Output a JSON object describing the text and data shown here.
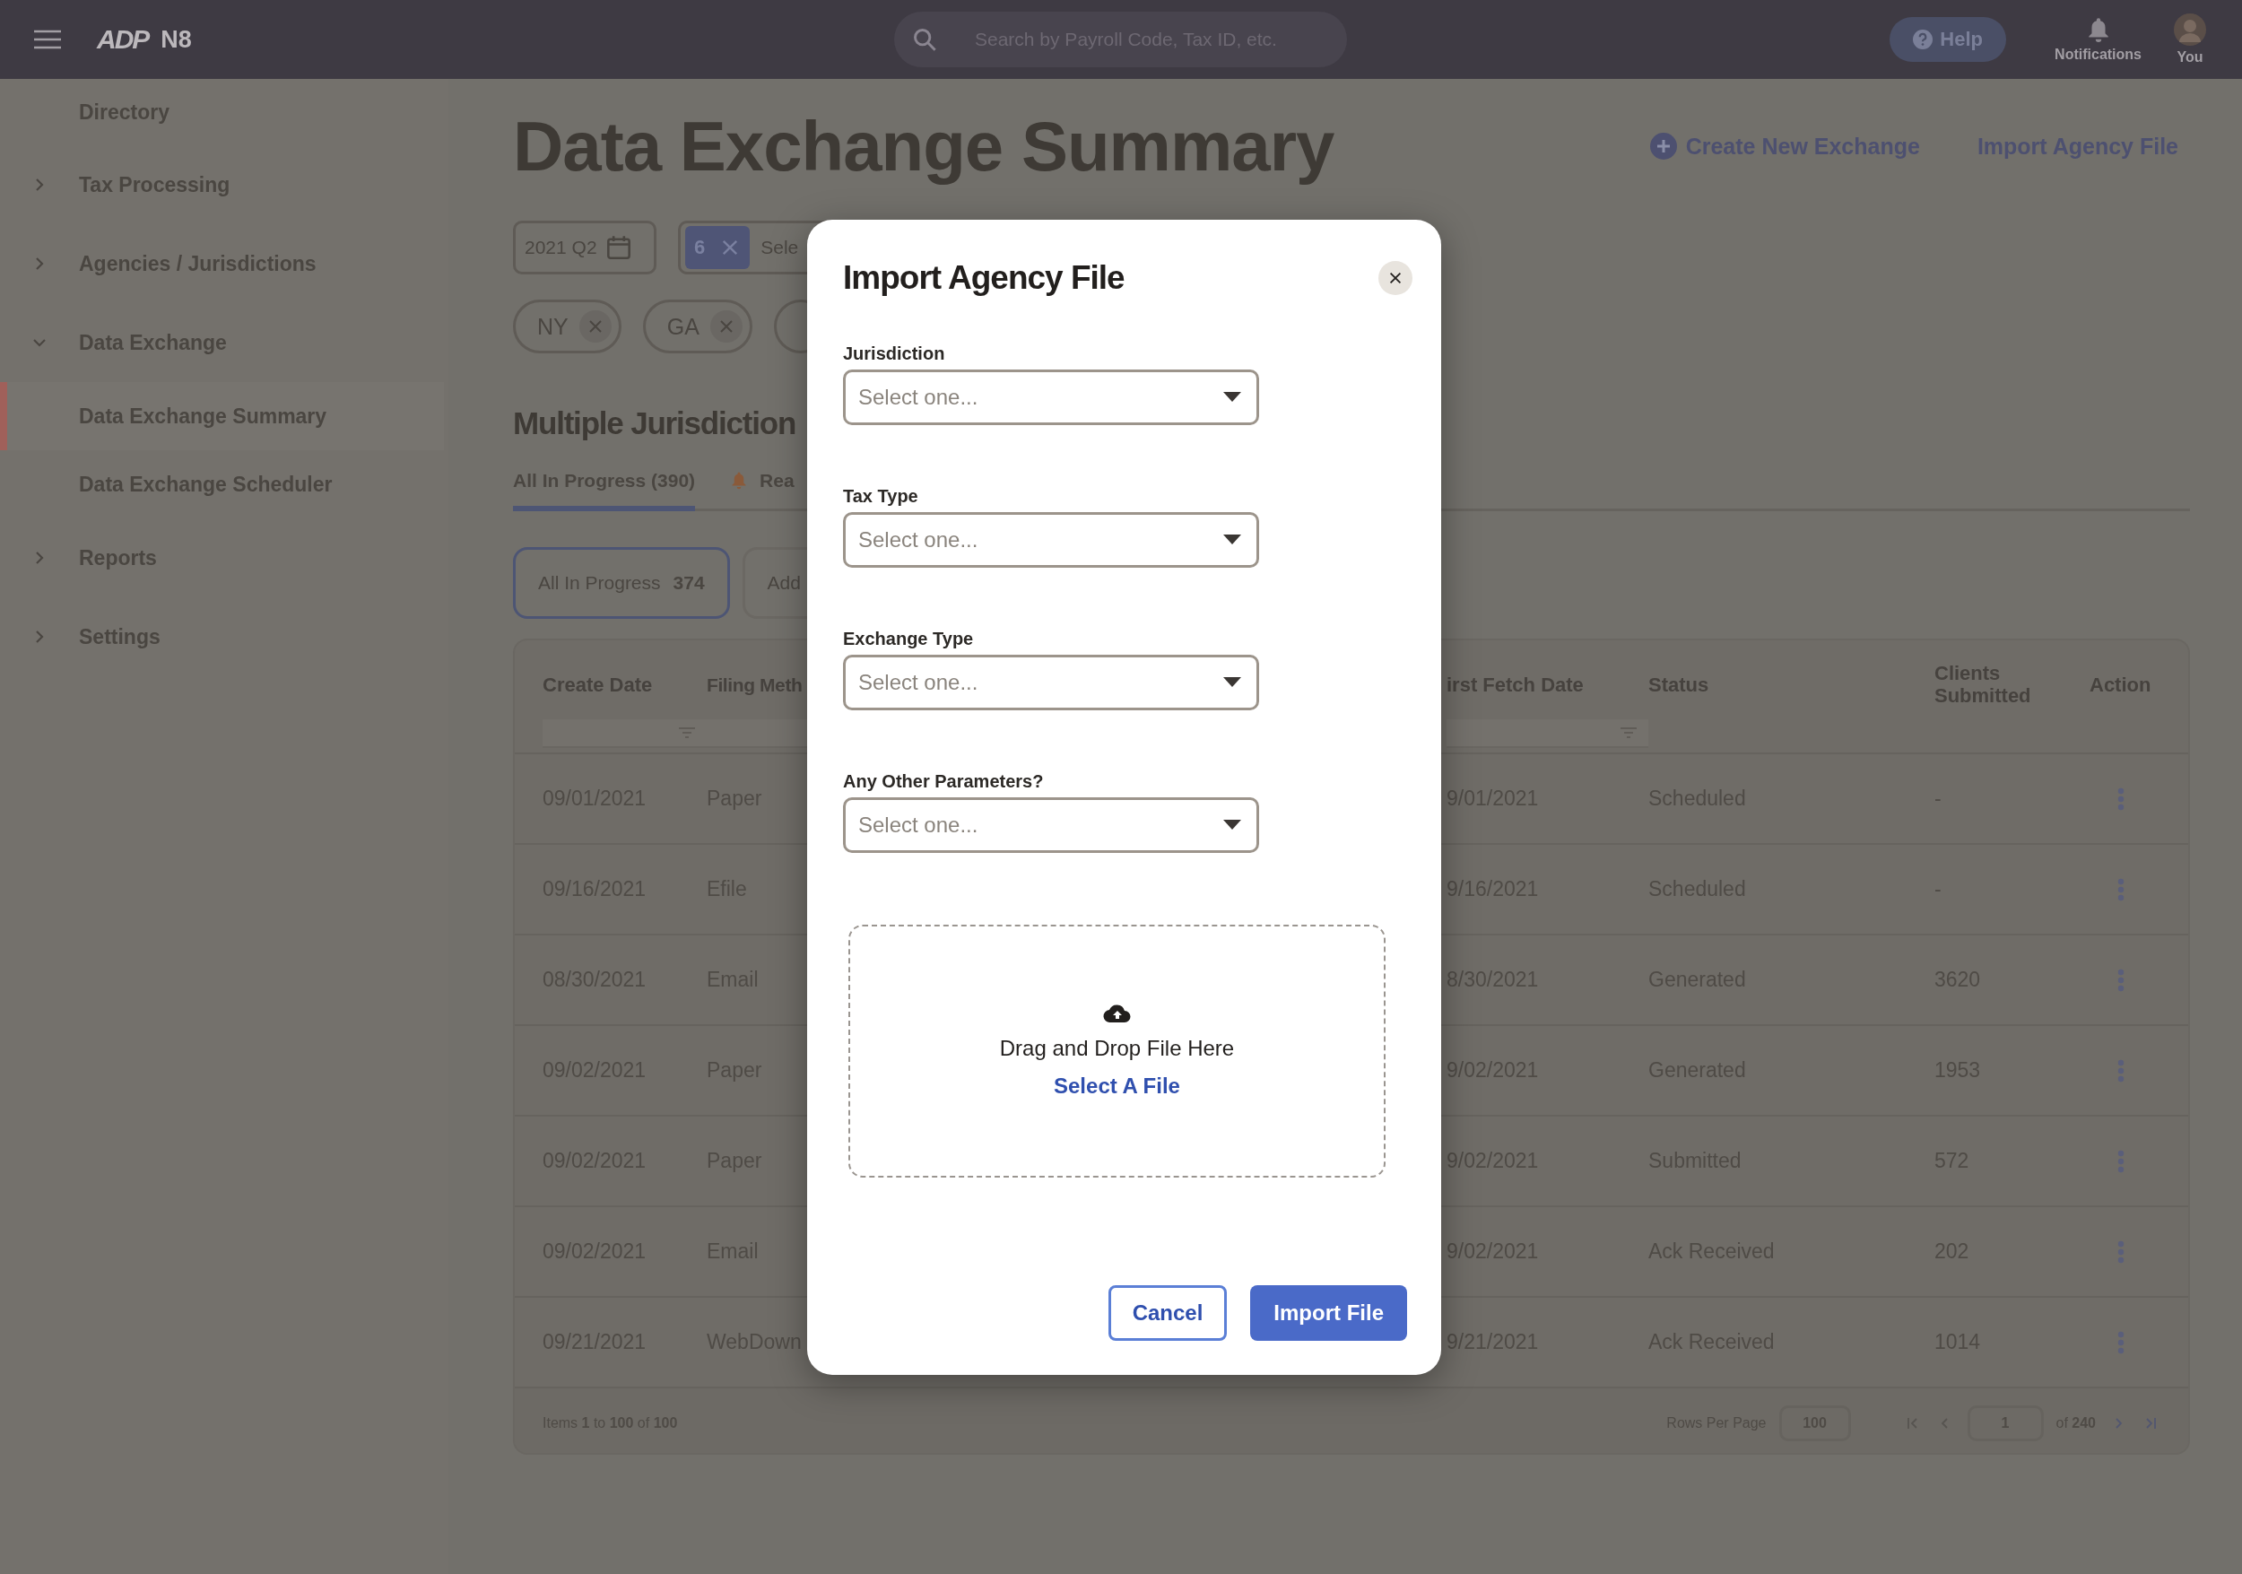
{
  "top_bar": {
    "logo": "ADP",
    "product": "N8",
    "search": {
      "placeholder": "Search by Payroll Code, Tax ID, etc."
    },
    "help": "Help",
    "notifications": "Notifications",
    "profile": "You"
  },
  "sidebar": {
    "items": [
      {
        "label": "Directory",
        "selected": false
      },
      {
        "label": "Tax Processing",
        "selected": false,
        "expanded": false
      },
      {
        "label": "Agencies / Jurisdictions",
        "selected": false,
        "expanded": false
      },
      {
        "label": "Data Exchange",
        "selected": false,
        "expanded": true,
        "children": [
          {
            "label": "Data Exchange Summary",
            "selected": true
          },
          {
            "label": "Data Exchange Scheduler",
            "selected": false
          }
        ]
      },
      {
        "label": "Reports",
        "selected": false,
        "expanded": false
      },
      {
        "label": "Settings",
        "selected": false,
        "expanded": false
      }
    ]
  },
  "page": {
    "title": "Data Exchange Summary",
    "actions": [
      {
        "label": "Create New Exchange",
        "kind": "add"
      },
      {
        "label": "Import Agency File",
        "kind": "plain"
      }
    ]
  },
  "filters": {
    "period": "2021 Q2",
    "multi": {
      "count": "6",
      "placeholder": "Sele"
    },
    "chips": [
      {
        "kind": "chip",
        "label": "NY"
      },
      {
        "kind": "chip",
        "label": "GA"
      },
      {
        "kind": "cut"
      }
    ]
  },
  "section": {
    "title": "Multiple Jurisdiction",
    "tabs": [
      {
        "label": "All In Progress (390)",
        "selected": true
      },
      {
        "label": "Rea",
        "selected": false,
        "kind": "alert"
      }
    ],
    "pills": [
      {
        "label": "All In Progress",
        "count": "374",
        "selected": true
      },
      {
        "label": "Add",
        "selected": false
      }
    ]
  },
  "table": {
    "columns": [
      {
        "label": "Create Date",
        "kind": "filter"
      },
      {
        "label": "Filing Meth",
        "kind": "filter_cut"
      },
      {
        "label": "irst Fetch Date",
        "kind": "filter"
      },
      {
        "label": "Status",
        "kind": "plain"
      },
      {
        "label": "Clients Submitted",
        "kind": "plain"
      },
      {
        "label": "Action",
        "kind": "plain"
      }
    ],
    "rows": [
      [
        "09/01/2021",
        "Paper",
        "9/01/2021",
        "Scheduled",
        "-"
      ],
      [
        "09/16/2021",
        "Efile",
        "9/16/2021",
        "Scheduled",
        "-"
      ],
      [
        "08/30/2021",
        "Email",
        "8/30/2021",
        "Generated",
        "3620"
      ],
      [
        "09/02/2021",
        "Paper",
        "9/02/2021",
        "Generated",
        "1953"
      ],
      [
        "09/02/2021",
        "Paper",
        "9/02/2021",
        "Submitted",
        "572"
      ],
      [
        "09/02/2021",
        "Email",
        "9/02/2021",
        "Ack Received",
        "202"
      ],
      [
        "09/21/2021",
        "WebDown",
        "9/21/2021",
        "Ack Received",
        "1014"
      ]
    ],
    "footer": {
      "items": "Items **1** to **100** of **100**",
      "rows_per_page": "Rows Per Page",
      "rows_value": "100",
      "page": "1",
      "of": "of **240**"
    }
  },
  "modal": {
    "title": "Import Agency File",
    "fields": [
      {
        "label": "Jurisdiction",
        "placeholder": "Select one..."
      },
      {
        "label": "Tax Type",
        "placeholder": "Select one..."
      },
      {
        "label": "Exchange Type",
        "placeholder": "Select one..."
      },
      {
        "label": "Any Other Parameters?",
        "placeholder": "Select one..."
      }
    ],
    "dropzone": {
      "text": "Drag and Drop File Here",
      "link": "Select A File"
    },
    "buttons": [
      {
        "label": "Cancel",
        "kind": "secondary"
      },
      {
        "label": "Import File",
        "kind": "primary"
      }
    ]
  }
}
